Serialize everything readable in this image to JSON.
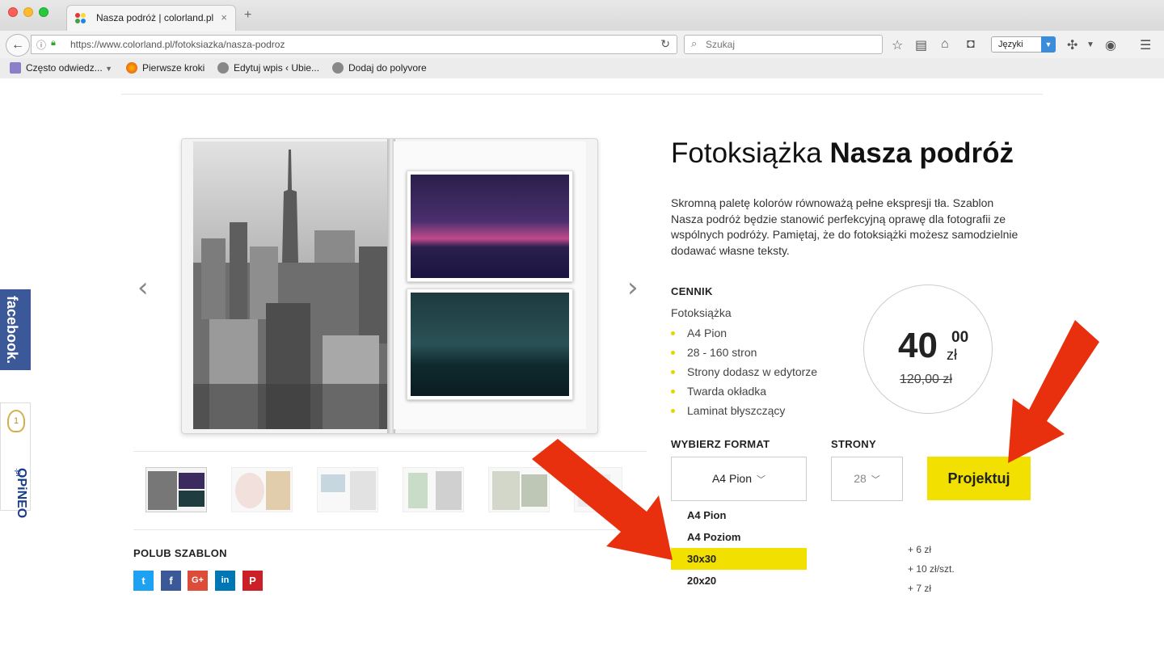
{
  "browser": {
    "tab_title": "Nasza podróż | colorland.pl",
    "tab_close": "×",
    "new_tab": "+",
    "url": "https://www.colorland.pl/fotoksiazka/nasza-podroz",
    "search_placeholder": "Szukaj",
    "lang_label": "Języki",
    "bookmarks": [
      "Często odwiedz...",
      "Pierwsze kroki",
      "Edytuj wpis ‹ Ubie...",
      "Dodaj do polyvore"
    ]
  },
  "side": {
    "facebook": "facebook.",
    "opineo": "OPiNEO",
    "opineo_sub": ".pl",
    "opineo_badge": "1"
  },
  "product": {
    "title_prefix": "Fotoksiążka",
    "title_name": "Nasza podróż",
    "description": "Skromną paletę kolorów równoważą pełne ekspresji tła. Szablon Nasza podróż będzie stanowić perfekcyjną oprawę dla fotografii ze wspólnych podróży. Pamiętaj, że do fotoksiążki możesz samodzielnie dodawać własne teksty."
  },
  "pricing": {
    "title": "CENNIK",
    "subtitle": "Fotoksiążka",
    "features": [
      "A4 Pion",
      "28 - 160 stron",
      "Strony dodasz w edytorze",
      "Twarda okładka",
      "Laminat błyszczący"
    ],
    "price_main": "40",
    "price_cents": "00",
    "currency": "zł",
    "price_old": "120,00 zł"
  },
  "order": {
    "format_label": "WYBIERZ FORMAT",
    "pages_label": "STRONY",
    "format_value": "A4 Pion",
    "pages_value": "28",
    "button": "Projektuj",
    "format_options": [
      "A4 Pion",
      "A4 Poziom",
      "30x30",
      "20x20"
    ],
    "selected_option": 2,
    "surcharges": [
      "+ 6 zł",
      "+ 10 zł/szt.",
      "+ 7 zł"
    ]
  },
  "share": {
    "title": "POLUB SZABLON",
    "buttons": [
      {
        "name": "twitter",
        "glyph": "t",
        "color": "#1da1f2"
      },
      {
        "name": "facebook",
        "glyph": "f",
        "color": "#3b5998"
      },
      {
        "name": "google-plus",
        "glyph": "G+",
        "color": "#dd4b39"
      },
      {
        "name": "linkedin",
        "glyph": "in",
        "color": "#0077b5"
      },
      {
        "name": "pinterest",
        "glyph": "P",
        "color": "#cb2027"
      }
    ]
  },
  "carousel": {
    "prev": "‹",
    "next": "›"
  },
  "colors": {
    "accent": "#f1e000",
    "arrow": "#e8300e"
  }
}
